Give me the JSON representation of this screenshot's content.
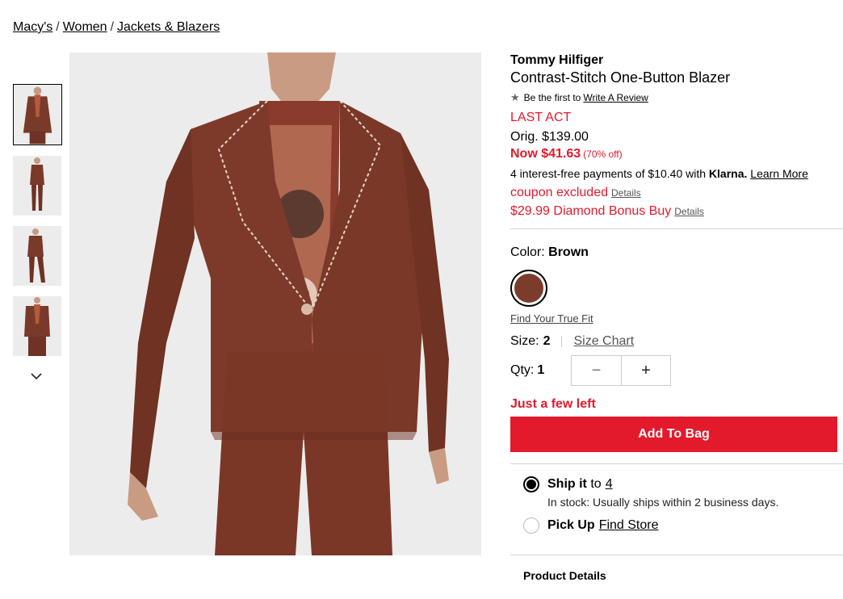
{
  "breadcrumb": [
    "Macy's",
    "Women",
    "Jackets & Blazers"
  ],
  "breadcrumb_sep": "/",
  "product": {
    "brand": "Tommy Hilfiger",
    "name": "Contrast-Stitch One-Button Blazer",
    "review_prefix": "Be the first to",
    "review_link": "Write A Review",
    "badge": "LAST ACT",
    "orig_price": "Orig. $139.00",
    "now_price": "Now $41.63",
    "discount": "(70% off)",
    "klarna_text": "4 interest-free payments of $10.40 with",
    "klarna_brand": "Klarna.",
    "klarna_link": "Learn More",
    "coupon_text": "coupon excluded",
    "coupon_link": "Details",
    "diamond_text": "$29.99 Diamond Bonus Buy",
    "diamond_link": "Details"
  },
  "color": {
    "label": "Color:",
    "value": "Brown",
    "swatch_hex": "#7b3c2c"
  },
  "fit_link": "Find Your True Fit",
  "size": {
    "label": "Size:",
    "value": "2",
    "chart_link": "Size Chart"
  },
  "qty": {
    "label": "Qty:",
    "value": "1",
    "minus": "−",
    "plus": "+"
  },
  "stock_warning": "Just a few left",
  "add_to_bag": "Add To Bag",
  "shipping": {
    "ship_label": "Ship it",
    "ship_to": "to",
    "ship_zip": "4",
    "stock_text": "In stock: Usually ships within 2 business days.",
    "pickup_label": "Pick Up",
    "pickup_link": "Find Store"
  },
  "product_details": "Product Details",
  "icons": {
    "star": "star-icon",
    "down": "chevron-down-icon"
  },
  "accent_color": "#e21a2c"
}
